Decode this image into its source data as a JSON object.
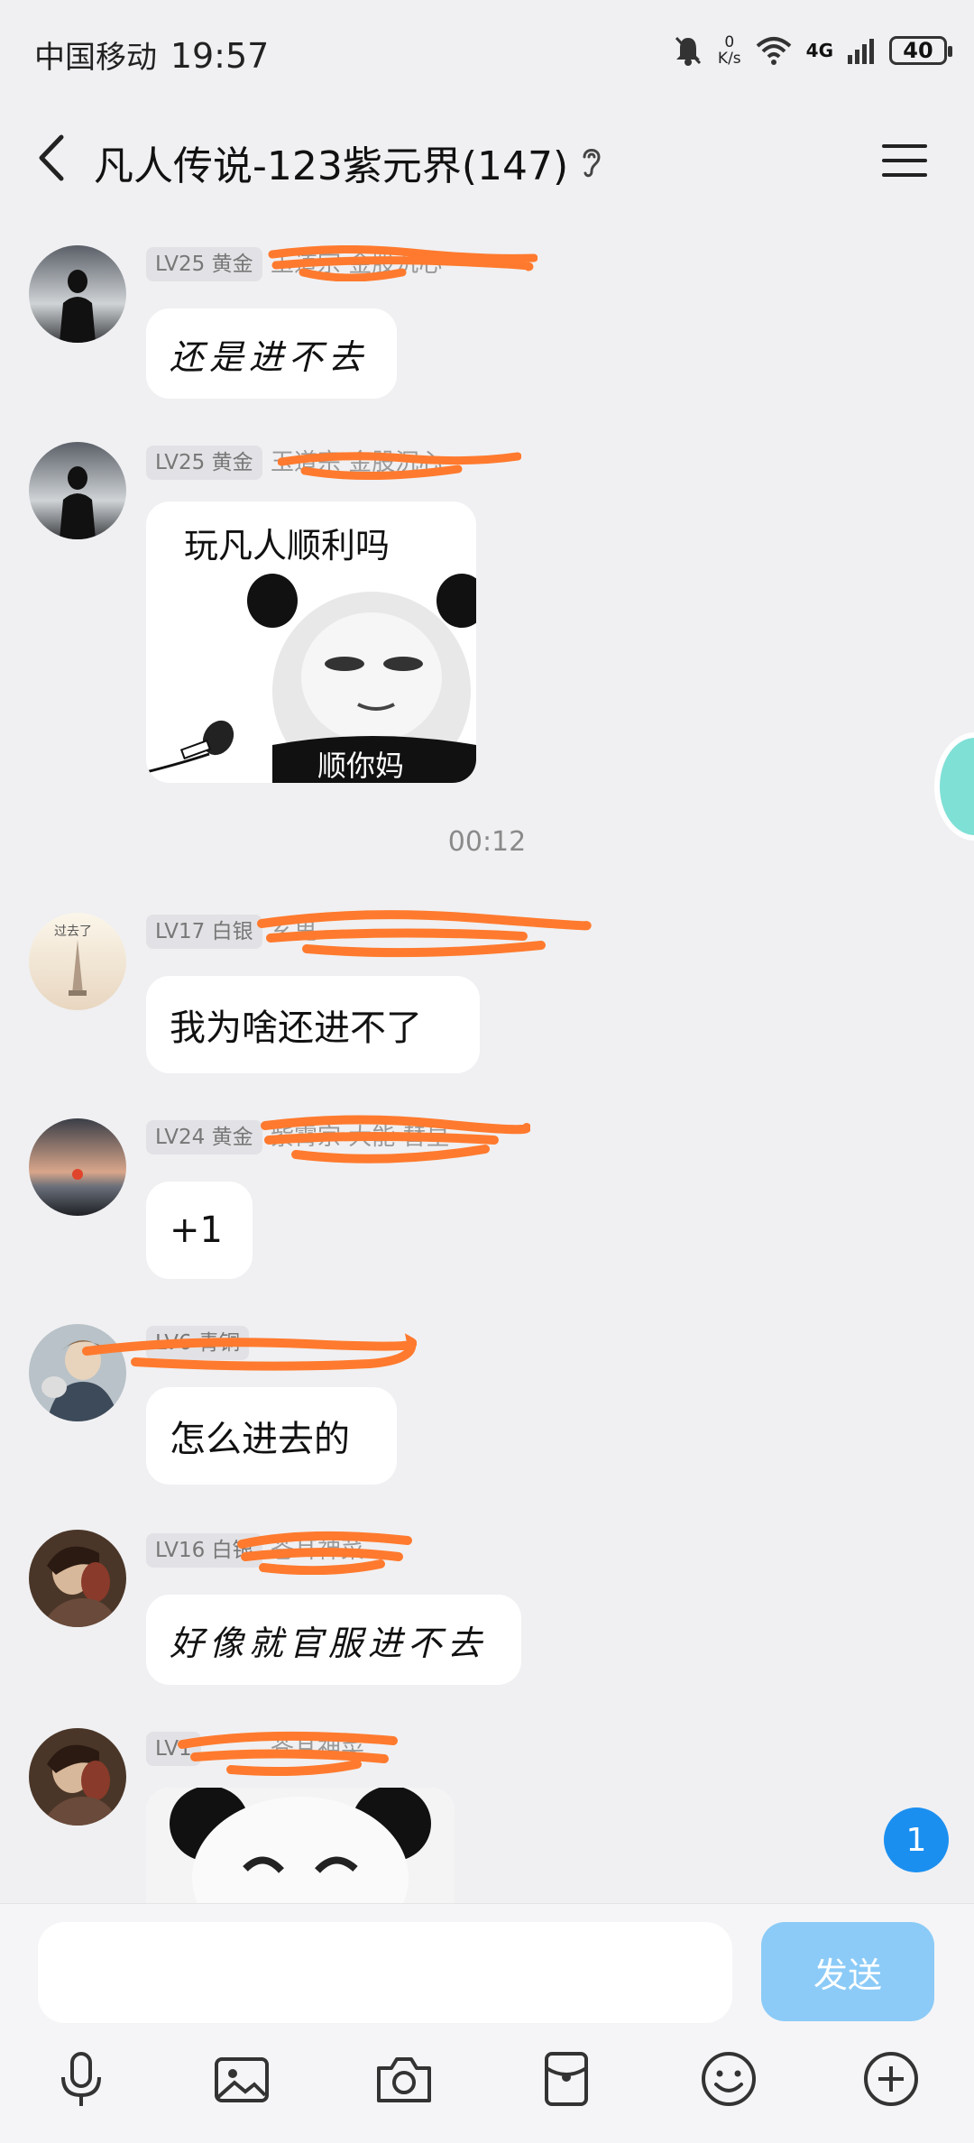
{
  "status_bar": {
    "carrier": "中国移动",
    "time": "19:57",
    "net_speed_value": "0",
    "net_speed_unit": "K/s",
    "network": "4G",
    "battery": "40"
  },
  "header": {
    "title": "凡人传说-123紫元界(147)",
    "back_icon": "chevron-left-icon",
    "ear_icon": "ear-icon",
    "menu_icon": "hamburger-menu-icon"
  },
  "messages": [
    {
      "level": "LV25 黄金",
      "nick": "玉道宗 金股沉心",
      "text": "还是进不去",
      "style": "handwritten"
    },
    {
      "level": "LV25 黄金",
      "nick": "玉道宗 金股沉心",
      "image_caption": "玩凡人顺利吗",
      "image_subcaption": "顺你妈",
      "type": "sticker"
    },
    {
      "timestamp": "00:12"
    },
    {
      "level": "LV17 白银",
      "nick": "玄鬼",
      "avatar_text": "过去了",
      "text": "我为啥还进不了"
    },
    {
      "level": "LV24 黄金",
      "nick": "紫霄宗 大能 替星",
      "text": "+1"
    },
    {
      "level": "LV6 青铜",
      "nick": "",
      "text": "怎么进去的"
    },
    {
      "level": "LV16 白银",
      "nick": "苍耳神菜",
      "text": "好像就官服进不去",
      "style": "handwritten"
    },
    {
      "level": "LV1",
      "nick": "苍耳神菜",
      "type": "sticker-partial"
    }
  ],
  "unread_count": "1",
  "composer": {
    "placeholder": "",
    "send_label": "发送",
    "tools": [
      "microphone-icon",
      "image-icon",
      "camera-icon",
      "red-packet-icon",
      "emoji-icon",
      "plus-icon"
    ]
  },
  "colors": {
    "background": "#f0f0f2",
    "bubble": "#ffffff",
    "send_button": "#8ccbf7",
    "unread_badge": "#1b8ff0",
    "redaction": "#ff7a2e"
  }
}
